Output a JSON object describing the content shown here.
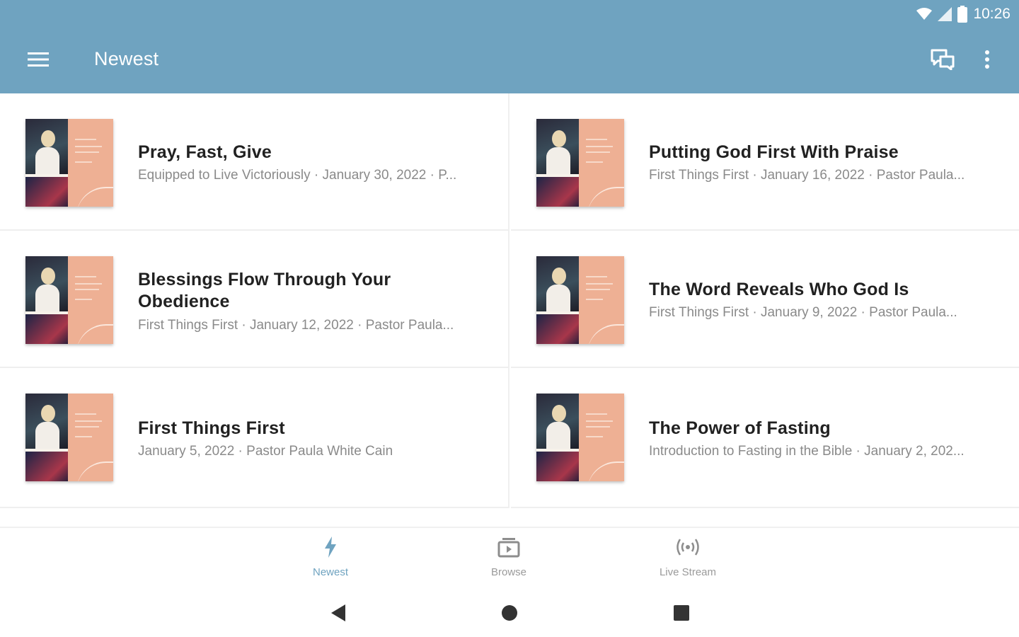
{
  "status_bar": {
    "time": "10:26",
    "icons": [
      "wifi-icon",
      "cellular-signal-icon",
      "battery-icon"
    ]
  },
  "app_bar": {
    "title": "Newest",
    "left_icon": "hamburger-menu-icon",
    "right_icons": [
      "chat-bubbles-icon",
      "more-vert-icon"
    ],
    "color": "#6fa3c0"
  },
  "items": [
    {
      "title": "Pray, Fast, Give",
      "subtitle": "Equipped to Live Victoriously · January 30, 2022 · P..."
    },
    {
      "title": "Putting God First With Praise",
      "subtitle": "First Things First · January 16, 2022 · Pastor Paula..."
    },
    {
      "title": "Blessings Flow Through Your Obedience",
      "subtitle": "First Things First · January 12, 2022 · Pastor Paula..."
    },
    {
      "title": "The Word Reveals Who God Is",
      "subtitle": "First Things First · January 9, 2022 · Pastor Paula..."
    },
    {
      "title": "First Things First",
      "subtitle": "January 5, 2022 · Pastor Paula White Cain"
    },
    {
      "title": "The Power of Fasting",
      "subtitle": "Introduction to Fasting in the Bible · January 2, 202..."
    }
  ],
  "bottom_nav": [
    {
      "label": "Newest",
      "icon": "lightning-bolt-icon",
      "active": true
    },
    {
      "label": "Browse",
      "icon": "browse-media-icon",
      "active": false
    },
    {
      "label": "Live Stream",
      "icon": "live-broadcast-icon",
      "active": false
    }
  ],
  "system_nav": {
    "icons": [
      "back-triangle-icon",
      "home-circle-icon",
      "recents-square-icon"
    ]
  },
  "colors": {
    "accent": "#6fa3c0",
    "title_text": "#212121",
    "subtitle_text": "#8a8a8a",
    "thumbnail": "#eeb094"
  }
}
